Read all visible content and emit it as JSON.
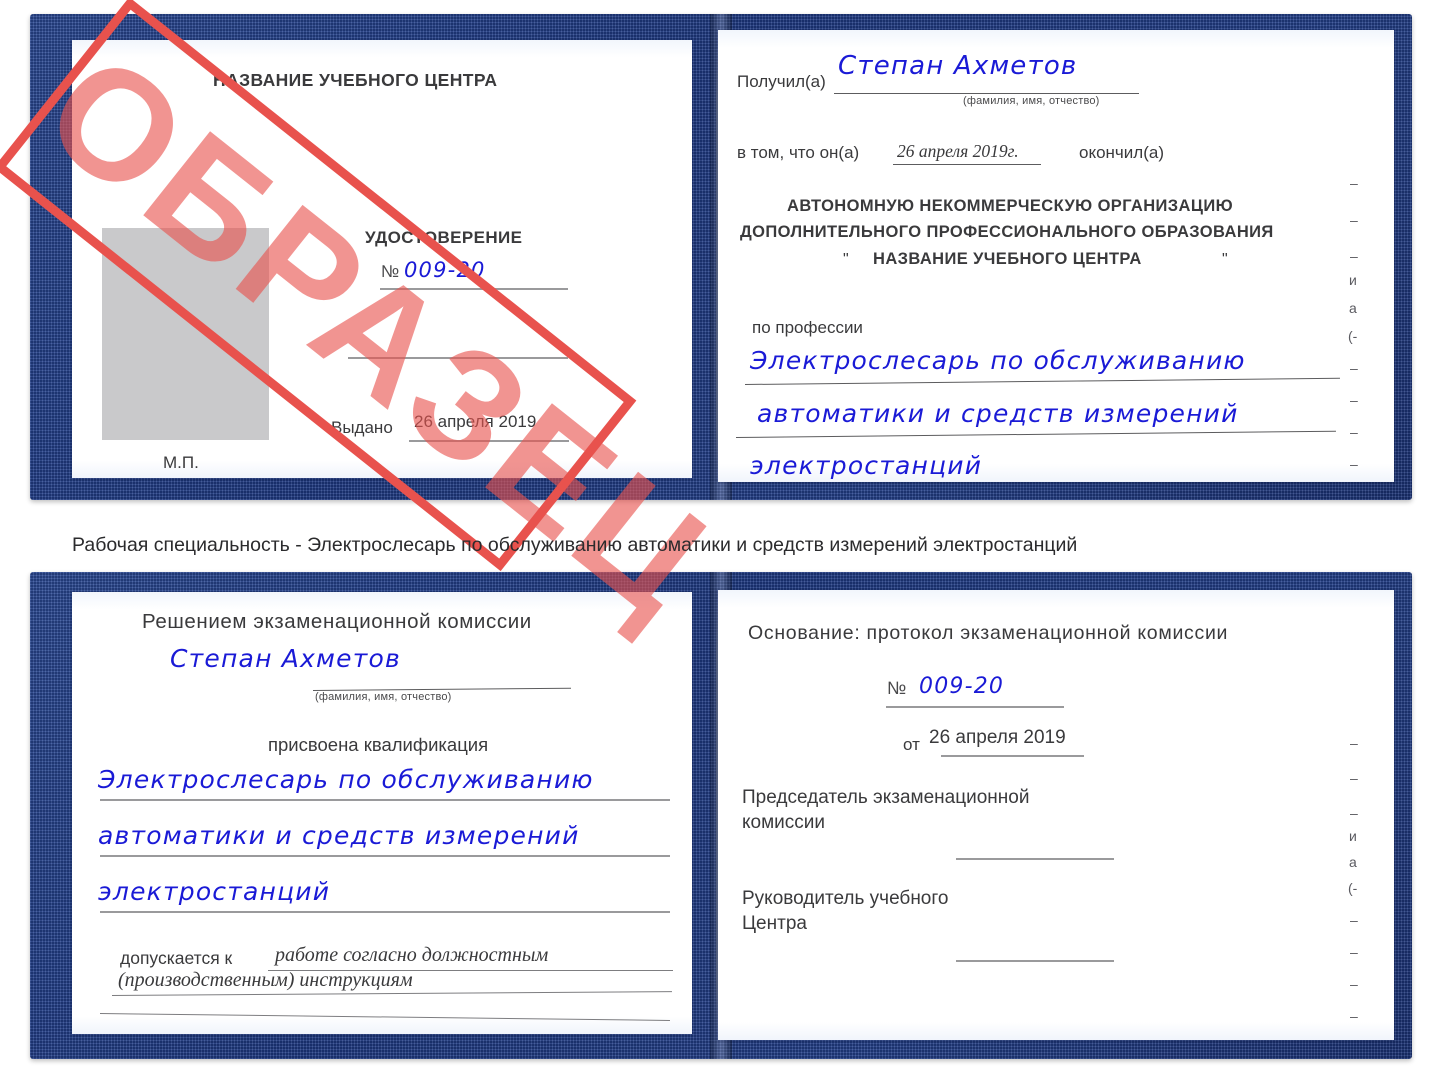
{
  "document": {
    "type": "certificate-scan",
    "caption": "Рабочая специальность - Электрослесарь по обслуживанию автоматики и средств измерений электростанций"
  },
  "stamp": {
    "text": "ОБРАЗЕЦ",
    "border_color": "#e8524d",
    "text_color": "#e8524d"
  },
  "colors": {
    "cover_blue": "#1e3a85",
    "handwriting_blue": "#1a1ad6",
    "printed_gray": "#3a3a3c",
    "photo_placeholder": "#c9c9cb",
    "stamp_red": "#e8524d"
  },
  "top_certificate": {
    "left_page": {
      "center_name": "НАЗВАНИЕ УЧЕБНОГО ЦЕНТРА",
      "title": "УДОСТОВЕРЕНИЕ",
      "number_label": "№",
      "number_value": "009-20",
      "issued_label": "Выдано",
      "issued_date": "26 апреля 2019",
      "seal_label": "М.П."
    },
    "right_page": {
      "received_label": "Получил(а)",
      "received_name": "Степан Ахметов",
      "name_hint": "(фамилия, имя, отчество)",
      "clause_prefix": "в том, что он(а)",
      "clause_date": "26 апреля 2019г.",
      "clause_suffix": "окончил(а)",
      "org_line1": "АВТОНОМНУЮ НЕКОММЕРЧЕСКУЮ ОРГАНИЗАЦИЮ",
      "org_line2": "ДОПОЛНИТЕЛЬНОГО ПРОФЕССИОНАЛЬНОГО ОБРАЗОВАНИЯ",
      "org_quote_open": "\"",
      "org_line3": "НАЗВАНИЕ УЧЕБНОГО ЦЕНТРА",
      "org_quote_close": "\"",
      "profession_label": "по профессии",
      "profession_line1": "Электрослесарь по обслуживанию",
      "profession_line2": "автоматики и средств измерений",
      "profession_line3": "электростанций",
      "edge_marks": [
        "–",
        "–",
        "–",
        "и",
        "а",
        "(-",
        "–",
        "–",
        "–",
        "–"
      ]
    }
  },
  "bottom_certificate": {
    "left_page": {
      "heading": "Решением экзаменационной комиссии",
      "name": "Степан Ахметов",
      "name_hint": "(фамилия, имя, отчество)",
      "qualification_label": "присвоена квалификация",
      "qualification_line1": "Электрослесарь по обслуживанию",
      "qualification_line2": "автоматики и средств измерений",
      "qualification_line3": "электростанций",
      "admitted_label": "допускается к",
      "admitted_line1": "работе согласно должностным",
      "admitted_line2": "(производственным) инструкциям"
    },
    "right_page": {
      "basis_label": "Основание: протокол экзаменационной комиссии",
      "number_label": "№",
      "number_value": "009-20",
      "date_label": "от",
      "date_value": "26 апреля 2019",
      "chairman_line1": "Председатель экзаменационной",
      "chairman_line2": "комиссии",
      "head_line1": "Руководитель учебного",
      "head_line2": "Центра",
      "edge_marks": [
        "–",
        "–",
        "–",
        "и",
        "а",
        "(-",
        "–",
        "–",
        "–",
        "–"
      ]
    }
  }
}
